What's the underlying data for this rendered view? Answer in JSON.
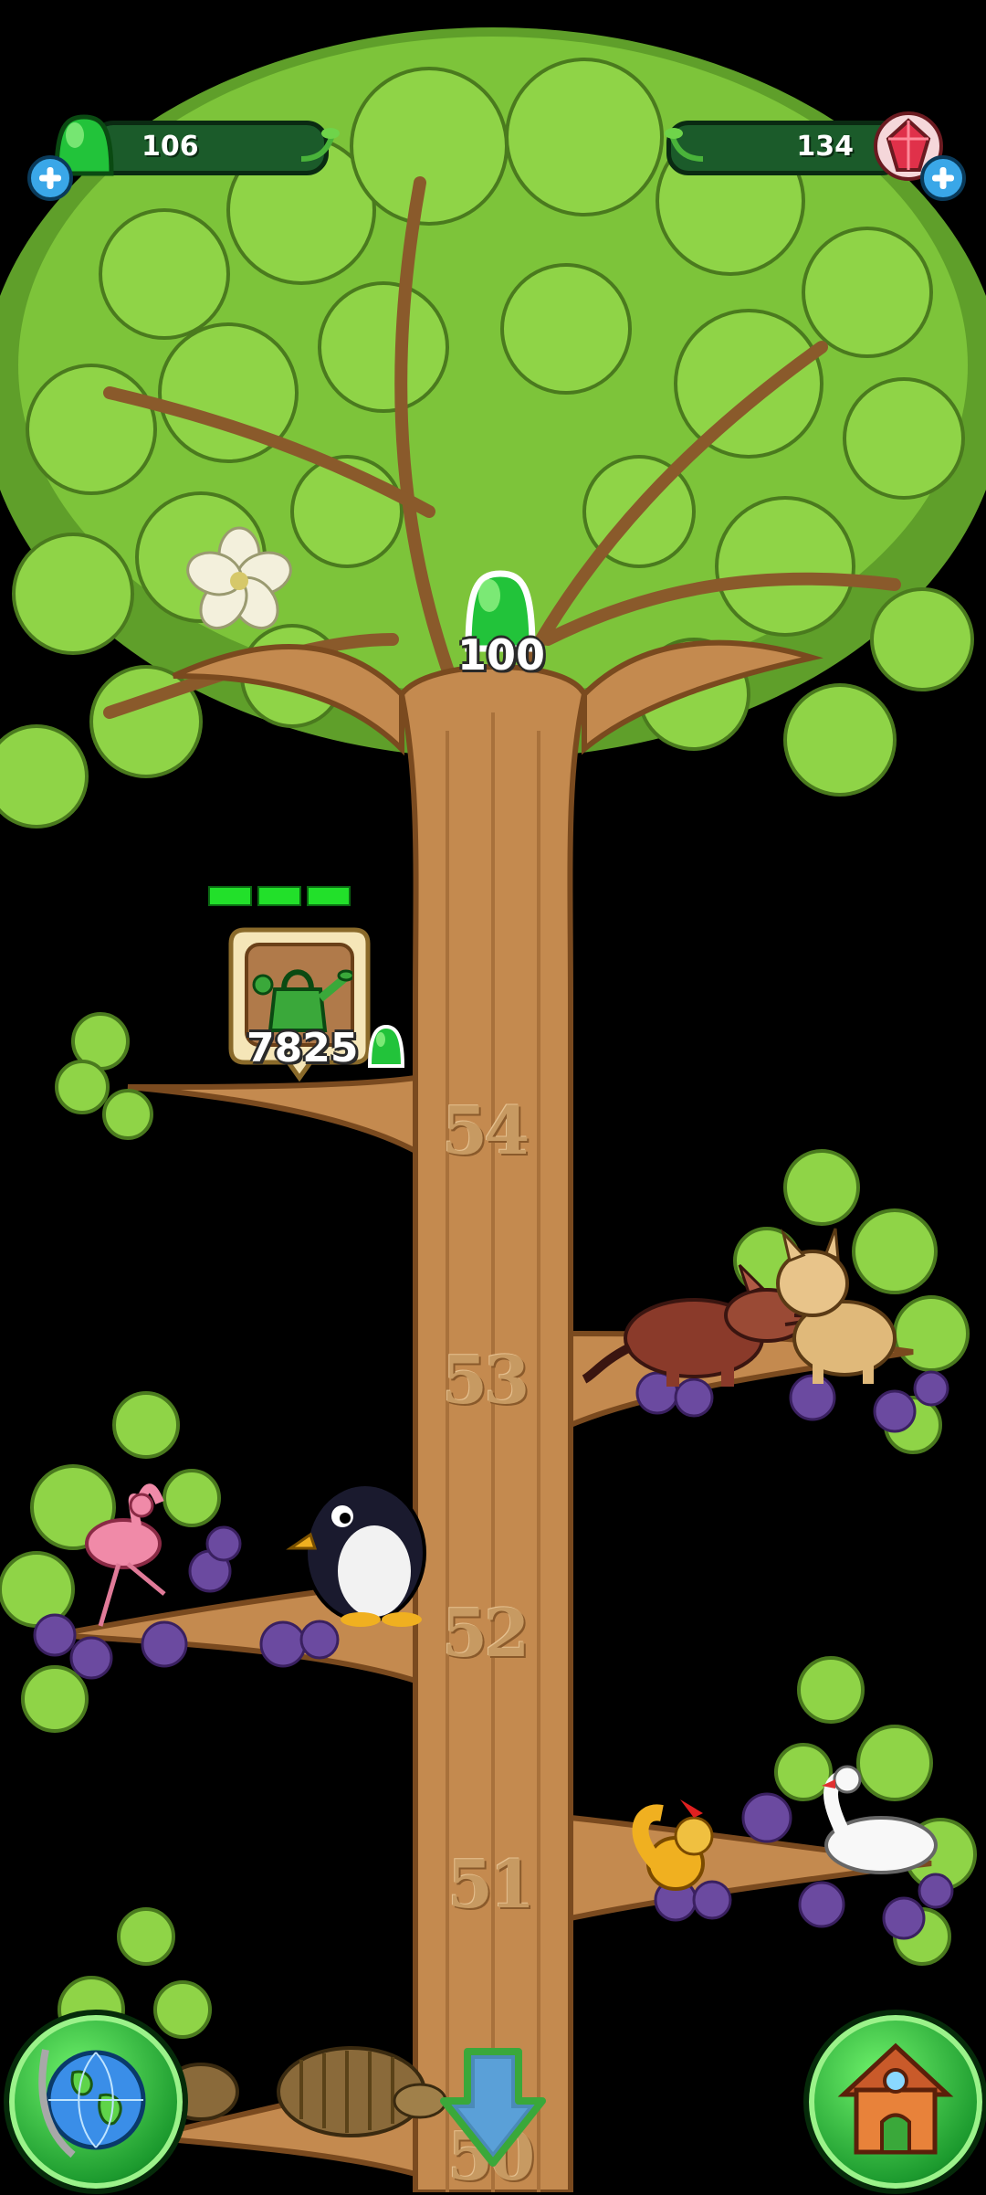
{
  "hud": {
    "gumdrops": {
      "value": "106",
      "icon": "green-gumdrop-icon",
      "plus_icon": "plus-icon"
    },
    "gems": {
      "value": "134",
      "icon": "red-gem-icon",
      "plus_icon": "plus-icon"
    }
  },
  "tree": {
    "top_reward": {
      "icon": "green-gumdrop-icon",
      "amount": "100"
    },
    "quest": {
      "icon": "watering-can-icon",
      "cost": "7825",
      "cost_icon": "green-gumdrop-icon",
      "progress_segments": 3
    },
    "branch_numbers": [
      "54",
      "53",
      "52",
      "51",
      "50"
    ],
    "animals": [
      "flower",
      "aardvark",
      "lynx",
      "flamingo",
      "penguin",
      "squirrel",
      "swan",
      "armadillo"
    ]
  },
  "bottom": {
    "globe_button_icon": "globe-icon",
    "scroll_down_icon": "down-arrow-icon",
    "home_button_icon": "house-icon"
  },
  "colors": {
    "leaf": "#7dc43a",
    "bark": "#c48a4f",
    "hud_green": "#1b5b2a",
    "gumdrop": "#22c33a"
  }
}
